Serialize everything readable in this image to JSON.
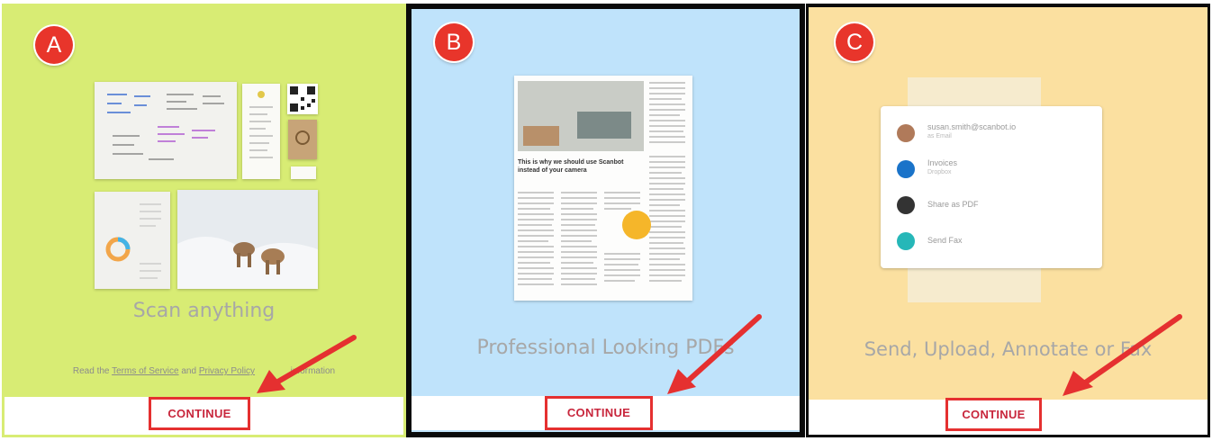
{
  "panels": [
    {
      "badge": "A",
      "title": "Scan anything",
      "legal_prefix": "Read the",
      "legal_tos": "Terms of Service",
      "legal_and": "and",
      "legal_privacy": "Privacy Policy",
      "legal_suffix": "information",
      "button": "CONTINUE"
    },
    {
      "badge": "B",
      "title": "Professional Looking PDFs",
      "article_headline": "This is why we should use Scanbot instead of your camera",
      "button": "CONTINUE"
    },
    {
      "badge": "C",
      "title": "Send, Upload, Annotate or Fax",
      "share": [
        {
          "label": "susan.smith@scanbot.io",
          "sub": "as Email"
        },
        {
          "label": "Invoices",
          "sub": "Dropbox"
        },
        {
          "label": "Share as PDF",
          "sub": ""
        },
        {
          "label": "Send Fax",
          "sub": ""
        }
      ],
      "button": "CONTINUE"
    }
  ],
  "colors": {
    "panel_a": "#d8ec74",
    "panel_b": "#bfe3fb",
    "panel_c": "#fbe0a0",
    "badge": "#e8352b",
    "annotation": "#e53030"
  }
}
